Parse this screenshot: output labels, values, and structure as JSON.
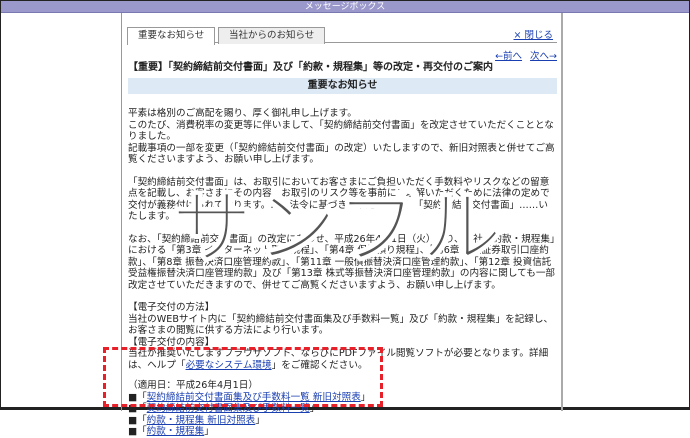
{
  "window": {
    "title": "メッセージボックス"
  },
  "tabs": [
    {
      "label": "重要なお知らせ",
      "active": true
    },
    {
      "label": "当社からのお知らせ",
      "active": false
    }
  ],
  "close_label": "× 閉じる",
  "nav": {
    "prev": "←前へ",
    "next": "次へ→"
  },
  "headline": "【重要】「契約締結前交付書面」及び「約款・規程集」等の改定・再交付のご案内",
  "band": "重要なお知らせ",
  "paragraphs": [
    "平素は格別のご高配を賜り、厚く御礼申し上げます。",
    "このたび、消費税率の変更等に伴いまして、「契約締結前交付書面」を改定させていただくこととなりました。",
    "記載事項の一部を変更（「契約締結前交付書面」の改定）いたしますので、新旧対照表と併せてご高覧くださいますよう、お願い申し上げます。",
    "「契約締結前交付書面」は、お取引においてお客さまにご負担いただく手数料やリスクなどの留意点を記載し、お客さまにその内容、お取引のリスク等を事前にご理解いただくために法律の定めで交付が義務付けられております。……法令に基づき、下記のとおり「契約締結前交付書面」……いたします。",
    "なお、「契約締結前交付書面」の改定にあわせ、平成26年4月1日（火）より、当社「約款・規程集」における「第3章 インターネット取引規程」、「第4章 保護預り規程」、「第6章 外国証券取引口座約款」、「第8章 振替決済口座管理約款」、「第11章 一般債振替決済口座管理約款」、「第12章 投資信託受益権振替決済口座管理約款」及び「第13章 株式等振替決済口座管理約款」の内容に関しても一部改定させていただきますので、併せてご高覧くださいますよう、お願い申し上げます。"
  ],
  "method": {
    "heading": "【電子交付の方法】",
    "text": "当社のWEBサイト内に「契約締結前交付書面集及び手数料一覧」及び「約款・規程集」を記録し、お客さまの閲覧に供する方法により行います。"
  },
  "contents": {
    "heading": "【電子交付の内容】",
    "text_before": "当社が推奨いたしますブラウザソフト、ならびにPDFファイル閲覧ソフトが必要となります。詳細は、ヘルプ「",
    "link": "必要なシステム環境",
    "text_after": "」をご確認ください。"
  },
  "effective_date": "（適用日：平成26年4月1日）",
  "documents": [
    "契約締結前交付書面集及び手数料一覧 新旧対照表",
    "契約締結前交付書面集及び手数料一覧",
    "約款・規程集 新旧対照表",
    "約款・規程集"
  ],
  "watermark": "サンプル",
  "colors": {
    "titlebar": "#9b98cc",
    "band": "#dde9f5",
    "link": "#1a3fb0",
    "highlight": "#e8202a"
  }
}
